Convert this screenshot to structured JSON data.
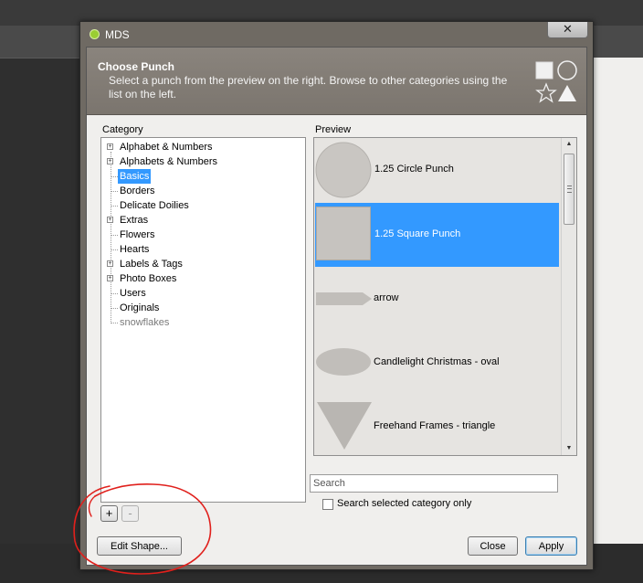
{
  "window": {
    "title": "MDS",
    "close_glyph": "✕",
    "app_icon": "mds-app-icon"
  },
  "header": {
    "title": "Choose Punch",
    "description": "Select a punch from the preview on the right. Browse to other categories using the list on the left.",
    "icon": "shapes-icon"
  },
  "category": {
    "label": "Category",
    "items": [
      {
        "label": "Alphabet & Numbers",
        "expandable": true
      },
      {
        "label": "Alphabets & Numbers",
        "expandable": true
      },
      {
        "label": "Basics",
        "expandable": false,
        "selected": true
      },
      {
        "label": "Borders",
        "expandable": false
      },
      {
        "label": "Delicate Doilies",
        "expandable": false
      },
      {
        "label": "Extras",
        "expandable": true
      },
      {
        "label": "Flowers",
        "expandable": false
      },
      {
        "label": "Hearts",
        "expandable": false
      },
      {
        "label": "Labels & Tags",
        "expandable": true
      },
      {
        "label": "Photo Boxes",
        "expandable": true
      },
      {
        "label": "Users",
        "expandable": false
      },
      {
        "label": "Originals",
        "expandable": false
      },
      {
        "label": "snowflakes",
        "expandable": false,
        "dim": true
      }
    ]
  },
  "preview": {
    "label": "Preview",
    "items": [
      {
        "label": "1.25 Circle Punch",
        "shape": "circle"
      },
      {
        "label": "1.25 Square Punch",
        "shape": "square",
        "selected": true
      },
      {
        "label": "arrow",
        "shape": "arrow"
      },
      {
        "label": "Candlelight Christmas - oval",
        "shape": "oval"
      },
      {
        "label": "Freehand Frames - triangle",
        "shape": "triangle"
      }
    ]
  },
  "search": {
    "placeholder": "Search",
    "value": "",
    "checkbox_label": "Search selected category only",
    "checked": false
  },
  "buttons": {
    "add": "+",
    "remove": "-",
    "edit_shape": "Edit Shape...",
    "close": "Close",
    "apply": "Apply"
  },
  "colors": {
    "selection": "#3399ff",
    "annotation": "#e0201c",
    "header_bg": "#7f7972"
  }
}
